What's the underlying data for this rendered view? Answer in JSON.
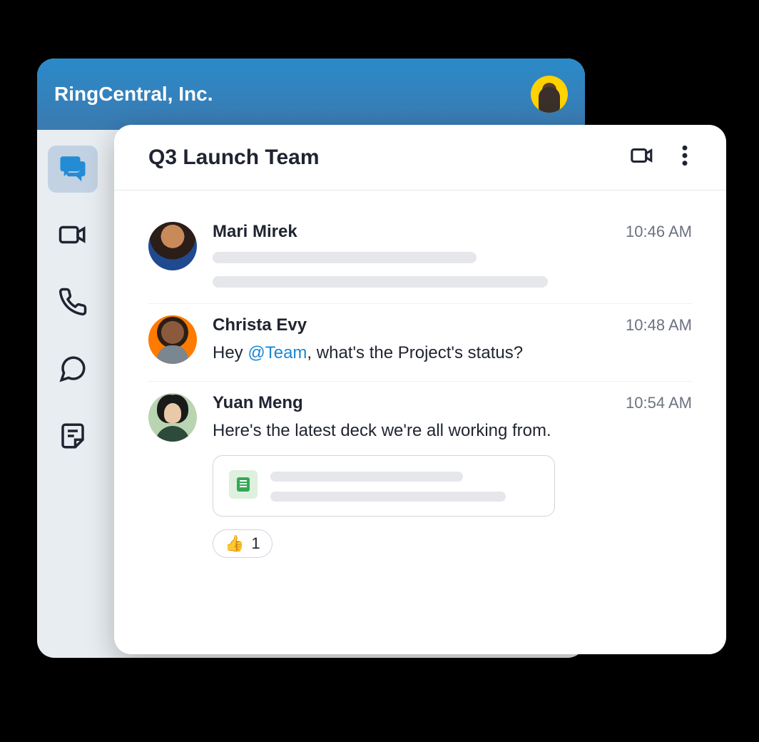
{
  "org_name": "RingCentral, Inc.",
  "chat": {
    "title": "Q3 Launch Team"
  },
  "messages": [
    {
      "author": "Mari Mirek",
      "time": "10:46 AM",
      "placeholder": true
    },
    {
      "author": "Christa Evy",
      "time": "10:48 AM",
      "text_pre": "Hey ",
      "mention": "@Team",
      "text_post": ", what's the Project's status?"
    },
    {
      "author": "Yuan Meng",
      "time": "10:54 AM",
      "text": "Here's the latest deck we're all working from.",
      "reaction": {
        "emoji": "👍",
        "count": "1"
      }
    }
  ]
}
